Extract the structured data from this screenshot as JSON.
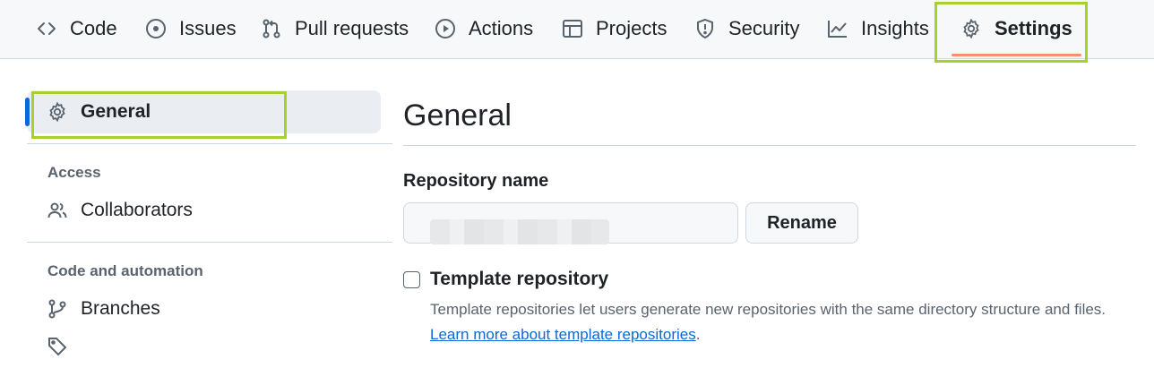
{
  "tabs": [
    {
      "label": "Code",
      "icon": "code-icon"
    },
    {
      "label": "Issues",
      "icon": "issue-circle-icon"
    },
    {
      "label": "Pull requests",
      "icon": "pull-request-icon"
    },
    {
      "label": "Actions",
      "icon": "play-icon"
    },
    {
      "label": "Projects",
      "icon": "table-icon"
    },
    {
      "label": "Security",
      "icon": "shield-icon"
    },
    {
      "label": "Insights",
      "icon": "graph-icon"
    },
    {
      "label": "Settings",
      "icon": "gear-icon",
      "active": true
    }
  ],
  "sidebar": {
    "general": "General",
    "access_heading": "Access",
    "collaborators": "Collaborators",
    "automation_heading": "Code and automation",
    "branches": "Branches"
  },
  "main": {
    "title": "General",
    "repo_name_label": "Repository name",
    "repo_name_value": "",
    "rename_label": "Rename",
    "template_label": "Template repository",
    "template_help": "Template repositories let users generate new repositories with the same directory structure and files.",
    "template_link": "Learn more about template repositories",
    "template_help_end": "."
  },
  "colors": {
    "accent": "#0969da",
    "underline": "#fd8c73",
    "highlight": "#a8d02a"
  }
}
